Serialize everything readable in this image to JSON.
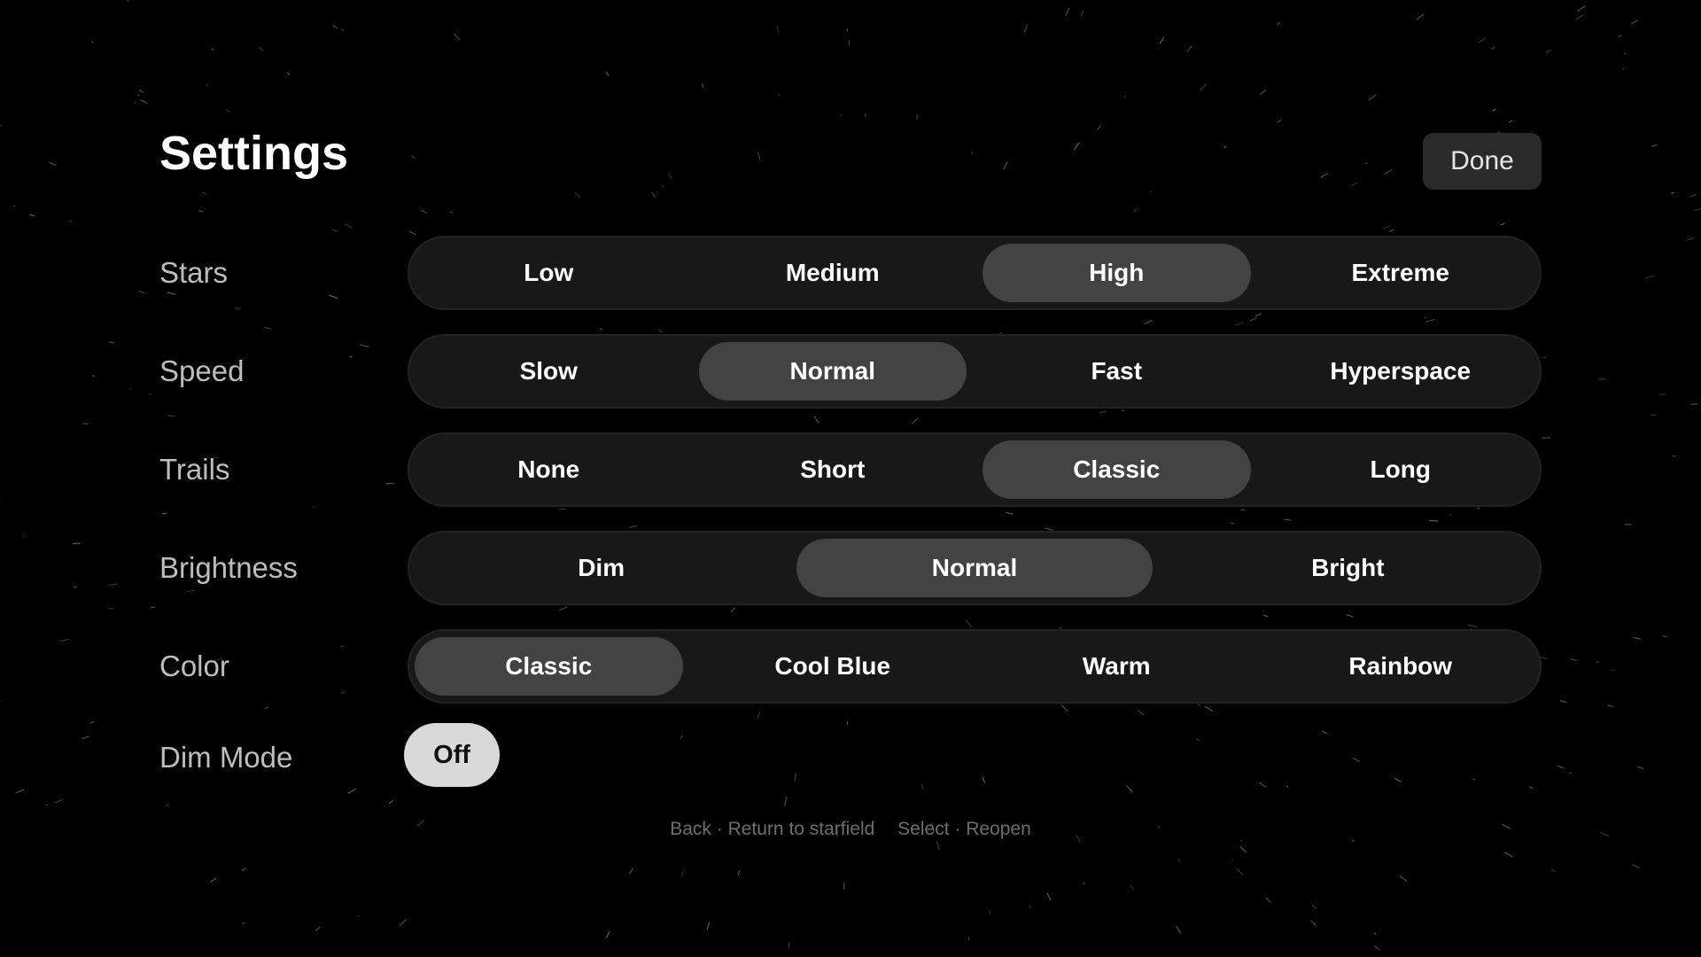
{
  "title": "Settings",
  "done_label": "Done",
  "settings": [
    {
      "label": "Stars",
      "options": [
        "Low",
        "Medium",
        "High",
        "Extreme"
      ],
      "selected": 2
    },
    {
      "label": "Speed",
      "options": [
        "Slow",
        "Normal",
        "Fast",
        "Hyperspace"
      ],
      "selected": 1
    },
    {
      "label": "Trails",
      "options": [
        "None",
        "Short",
        "Classic",
        "Long"
      ],
      "selected": 2
    },
    {
      "label": "Brightness",
      "options": [
        "Dim",
        "Normal",
        "Bright"
      ],
      "selected": 1
    },
    {
      "label": "Color",
      "options": [
        "Classic",
        "Cool Blue",
        "Warm",
        "Rainbow"
      ],
      "selected": 0
    }
  ],
  "dim_mode": {
    "label": "Dim Mode",
    "value": "Off"
  },
  "hints": {
    "back": "Back · Return to starfield",
    "select": "Select · Reopen"
  },
  "colors": {
    "background": "#000000",
    "panel": "#181818",
    "selected": "#434343",
    "toggle_off": "#d9d9d9"
  }
}
